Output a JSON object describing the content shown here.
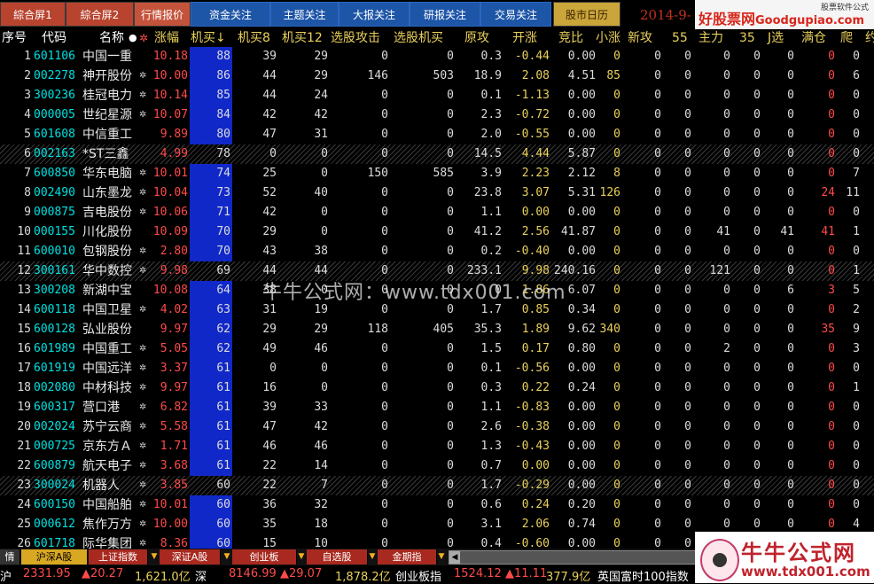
{
  "top_tabs": [
    "綜合屏1",
    "綜合屏2",
    "行情报价",
    "资金关注",
    "主题关注",
    "大报关注",
    "研报关注",
    "交易关注",
    "股市日历"
  ],
  "date_text": "2014-9-",
  "brand": {
    "main": "好股票网",
    "sub": "Goodgupiao.com",
    "corner": "股票软件公式"
  },
  "headers": [
    "序号",
    "代码",
    "名称",
    "●",
    "✲",
    "涨幅",
    "机买↓",
    "机买8",
    "机买12",
    "选股攻击",
    "选股机买",
    "原攻",
    "开涨",
    "竞比",
    "小涨",
    "新攻",
    "55",
    "主力",
    "35",
    "J选",
    "满仓",
    "爬",
    "约"
  ],
  "rows": [
    {
      "no": "1",
      "code": "601106",
      "name": "中国一重",
      "mark": "",
      "zf": "10.18",
      "jm": "88",
      "jm8": "39",
      "jm12": "29",
      "xg": "0",
      "xgj": "0",
      "yg": "0.3",
      "kz": "-0.44",
      "jb": "0.00",
      "xz": "0",
      "xg2": "0",
      "a": "0",
      "zl": "0",
      "b": "0",
      "jx": "0",
      "mc": "0",
      "p": "0",
      "hatch": false
    },
    {
      "no": "2",
      "code": "002278",
      "name": "神开股份",
      "mark": "✲",
      "zf": "10.00",
      "jm": "86",
      "jm8": "44",
      "jm12": "29",
      "xg": "146",
      "xgj": "503",
      "yg": "18.9",
      "kz": "2.08",
      "jb": "4.51",
      "xz": "85",
      "xg2": "0",
      "a": "0",
      "zl": "0",
      "b": "0",
      "jx": "0",
      "mc": "0",
      "p": "6",
      "hatch": false
    },
    {
      "no": "3",
      "code": "300236",
      "name": "桂冠电力",
      "mark": "✲",
      "zf": "10.14",
      "jm": "85",
      "jm8": "44",
      "jm12": "24",
      "xg": "0",
      "xgj": "0",
      "yg": "0.1",
      "kz": "-1.13",
      "jb": "0.00",
      "xz": "0",
      "xg2": "0",
      "a": "0",
      "zl": "0",
      "b": "0",
      "jx": "0",
      "mc": "0",
      "p": "0",
      "hatch": false
    },
    {
      "no": "4",
      "code": "000005",
      "name": "世纪星源",
      "mark": "✲",
      "zf": "10.07",
      "jm": "84",
      "jm8": "42",
      "jm12": "42",
      "xg": "0",
      "xgj": "0",
      "yg": "2.3",
      "kz": "-0.72",
      "jb": "0.00",
      "xz": "0",
      "xg2": "0",
      "a": "0",
      "zl": "0",
      "b": "0",
      "jx": "0",
      "mc": "0",
      "p": "0",
      "hatch": false
    },
    {
      "no": "5",
      "code": "601608",
      "name": "中信重工",
      "mark": "",
      "zf": "9.89",
      "jm": "80",
      "jm8": "47",
      "jm12": "31",
      "xg": "0",
      "xgj": "0",
      "yg": "2.0",
      "kz": "-0.55",
      "jb": "0.00",
      "xz": "0",
      "xg2": "0",
      "a": "0",
      "zl": "0",
      "b": "0",
      "jx": "0",
      "mc": "0",
      "p": "0",
      "hatch": false
    },
    {
      "no": "6",
      "code": "002163",
      "name": "*ST三鑫",
      "mark": "",
      "zf": "4.99",
      "jm": "78",
      "jm8": "0",
      "jm12": "0",
      "xg": "0",
      "xgj": "0",
      "yg": "14.5",
      "kz": "4.44",
      "jb": "5.87",
      "xz": "0",
      "xg2": "0",
      "a": "0",
      "zl": "0",
      "b": "0",
      "jx": "0",
      "mc": "0",
      "p": "0",
      "hatch": true
    },
    {
      "no": "7",
      "code": "600850",
      "name": "华东电脑",
      "mark": "✲",
      "zf": "10.01",
      "jm": "74",
      "jm8": "25",
      "jm12": "0",
      "xg": "150",
      "xgj": "585",
      "yg": "3.9",
      "kz": "2.23",
      "jb": "2.12",
      "xz": "8",
      "xg2": "0",
      "a": "0",
      "zl": "0",
      "b": "0",
      "jx": "0",
      "mc": "0",
      "p": "7",
      "hatch": false
    },
    {
      "no": "8",
      "code": "002490",
      "name": "山东墨龙",
      "mark": "✲",
      "zf": "10.04",
      "jm": "73",
      "jm8": "52",
      "jm12": "40",
      "xg": "0",
      "xgj": "0",
      "yg": "23.8",
      "kz": "3.07",
      "jb": "5.31",
      "xz": "126",
      "xg2": "0",
      "a": "0",
      "zl": "0",
      "b": "0",
      "jx": "0",
      "mc": "24",
      "p": "11",
      "hatch": false
    },
    {
      "no": "9",
      "code": "000875",
      "name": "吉电股份",
      "mark": "✲",
      "zf": "10.06",
      "jm": "71",
      "jm8": "42",
      "jm12": "0",
      "xg": "0",
      "xgj": "0",
      "yg": "1.1",
      "kz": "0.00",
      "jb": "0.00",
      "xz": "0",
      "xg2": "0",
      "a": "0",
      "zl": "0",
      "b": "0",
      "jx": "0",
      "mc": "0",
      "p": "0",
      "hatch": false
    },
    {
      "no": "10",
      "code": "000155",
      "name": "川化股份",
      "mark": "",
      "zf": "10.09",
      "jm": "70",
      "jm8": "29",
      "jm12": "0",
      "xg": "0",
      "xgj": "0",
      "yg": "41.2",
      "kz": "2.56",
      "jb": "41.87",
      "xz": "0",
      "xg2": "0",
      "a": "0",
      "zl": "41",
      "b": "0",
      "jx": "41",
      "mc": "41",
      "p": "1",
      "hatch": false
    },
    {
      "no": "11",
      "code": "600010",
      "name": "包钢股份",
      "mark": "✲",
      "zf": "2.80",
      "jm": "70",
      "jm8": "43",
      "jm12": "38",
      "xg": "0",
      "xgj": "0",
      "yg": "0.2",
      "kz": "-0.40",
      "jb": "0.00",
      "xz": "0",
      "xg2": "0",
      "a": "0",
      "zl": "0",
      "b": "0",
      "jx": "0",
      "mc": "0",
      "p": "0",
      "hatch": false
    },
    {
      "no": "12",
      "code": "300161",
      "name": "华中数控",
      "mark": "✲",
      "zf": "9.98",
      "jm": "69",
      "jm8": "44",
      "jm12": "44",
      "xg": "0",
      "xgj": "0",
      "yg": "233.1",
      "kz": "9.98",
      "jb": "240.16",
      "xz": "0",
      "xg2": "0",
      "a": "0",
      "zl": "121",
      "b": "0",
      "jx": "0",
      "mc": "0",
      "p": "1",
      "hatch": true
    },
    {
      "no": "13",
      "code": "300208",
      "name": "新湖中宝",
      "mark": "",
      "zf": "10.08",
      "jm": "64",
      "jm8": "38",
      "jm12": "0",
      "xg": "0",
      "xgj": "0",
      "yg": "0",
      "kz": "1.86",
      "jb": "6.07",
      "xz": "0",
      "xg2": "0",
      "a": "0",
      "zl": "0",
      "b": "0",
      "jx": "6",
      "mc": "3",
      "p": "5",
      "hatch": false
    },
    {
      "no": "14",
      "code": "600118",
      "name": "中国卫星",
      "mark": "✲",
      "zf": "4.02",
      "jm": "63",
      "jm8": "31",
      "jm12": "19",
      "xg": "0",
      "xgj": "0",
      "yg": "1.7",
      "kz": "0.85",
      "jb": "0.34",
      "xz": "0",
      "xg2": "0",
      "a": "0",
      "zl": "0",
      "b": "0",
      "jx": "0",
      "mc": "0",
      "p": "2",
      "hatch": false
    },
    {
      "no": "15",
      "code": "600128",
      "name": "弘业股份",
      "mark": "",
      "zf": "9.97",
      "jm": "62",
      "jm8": "29",
      "jm12": "29",
      "xg": "118",
      "xgj": "405",
      "yg": "35.3",
      "kz": "1.89",
      "jb": "9.62",
      "xz": "340",
      "xg2": "0",
      "a": "0",
      "zl": "0",
      "b": "0",
      "jx": "0",
      "mc": "35",
      "p": "9",
      "hatch": false
    },
    {
      "no": "16",
      "code": "601989",
      "name": "中国重工",
      "mark": "✲",
      "zf": "5.05",
      "jm": "62",
      "jm8": "49",
      "jm12": "46",
      "xg": "0",
      "xgj": "0",
      "yg": "1.5",
      "kz": "0.17",
      "jb": "0.80",
      "xz": "0",
      "xg2": "0",
      "a": "0",
      "zl": "2",
      "b": "0",
      "jx": "0",
      "mc": "0",
      "p": "3",
      "hatch": false
    },
    {
      "no": "17",
      "code": "601919",
      "name": "中国远洋",
      "mark": "✲",
      "zf": "3.37",
      "jm": "61",
      "jm8": "0",
      "jm12": "0",
      "xg": "0",
      "xgj": "0",
      "yg": "0.1",
      "kz": "-0.56",
      "jb": "0.00",
      "xz": "0",
      "xg2": "0",
      "a": "0",
      "zl": "0",
      "b": "0",
      "jx": "0",
      "mc": "0",
      "p": "0",
      "hatch": false
    },
    {
      "no": "18",
      "code": "002080",
      "name": "中材科技",
      "mark": "✲",
      "zf": "9.97",
      "jm": "61",
      "jm8": "16",
      "jm12": "0",
      "xg": "0",
      "xgj": "0",
      "yg": "0.3",
      "kz": "0.22",
      "jb": "0.24",
      "xz": "0",
      "xg2": "0",
      "a": "0",
      "zl": "0",
      "b": "0",
      "jx": "0",
      "mc": "0",
      "p": "1",
      "hatch": false
    },
    {
      "no": "19",
      "code": "600317",
      "name": "营口港",
      "mark": "✲",
      "zf": "6.82",
      "jm": "61",
      "jm8": "39",
      "jm12": "33",
      "xg": "0",
      "xgj": "0",
      "yg": "1.1",
      "kz": "-0.83",
      "jb": "0.00",
      "xz": "0",
      "xg2": "0",
      "a": "0",
      "zl": "0",
      "b": "0",
      "jx": "0",
      "mc": "0",
      "p": "0",
      "hatch": false
    },
    {
      "no": "20",
      "code": "002024",
      "name": "苏宁云商",
      "mark": "✲",
      "zf": "5.58",
      "jm": "61",
      "jm8": "47",
      "jm12": "42",
      "xg": "0",
      "xgj": "0",
      "yg": "2.6",
      "kz": "-0.38",
      "jb": "0.00",
      "xz": "0",
      "xg2": "0",
      "a": "0",
      "zl": "0",
      "b": "0",
      "jx": "0",
      "mc": "0",
      "p": "0",
      "hatch": false
    },
    {
      "no": "21",
      "code": "000725",
      "name": "京东方Ａ",
      "mark": "✲",
      "zf": "1.71",
      "jm": "61",
      "jm8": "46",
      "jm12": "46",
      "xg": "0",
      "xgj": "0",
      "yg": "1.3",
      "kz": "-0.43",
      "jb": "0.00",
      "xz": "0",
      "xg2": "0",
      "a": "0",
      "zl": "0",
      "b": "0",
      "jx": "0",
      "mc": "0",
      "p": "0",
      "hatch": false
    },
    {
      "no": "22",
      "code": "600879",
      "name": "航天电子",
      "mark": "✲",
      "zf": "3.68",
      "jm": "61",
      "jm8": "22",
      "jm12": "14",
      "xg": "0",
      "xgj": "0",
      "yg": "0.7",
      "kz": "0.00",
      "jb": "0.00",
      "xz": "0",
      "xg2": "0",
      "a": "0",
      "zl": "0",
      "b": "0",
      "jx": "0",
      "mc": "0",
      "p": "0",
      "hatch": false
    },
    {
      "no": "23",
      "code": "300024",
      "name": "机器人",
      "mark": "✲",
      "zf": "3.85",
      "jm": "60",
      "jm8": "22",
      "jm12": "7",
      "xg": "0",
      "xgj": "0",
      "yg": "1.7",
      "kz": "-0.29",
      "jb": "0.00",
      "xz": "0",
      "xg2": "0",
      "a": "0",
      "zl": "0",
      "b": "0",
      "jx": "0",
      "mc": "0",
      "p": "0",
      "hatch": true
    },
    {
      "no": "24",
      "code": "600150",
      "name": "中国船舶",
      "mark": "✲",
      "zf": "10.01",
      "jm": "60",
      "jm8": "36",
      "jm12": "32",
      "xg": "0",
      "xgj": "0",
      "yg": "0.6",
      "kz": "0.24",
      "jb": "0.20",
      "xz": "0",
      "xg2": "0",
      "a": "0",
      "zl": "0",
      "b": "0",
      "jx": "0",
      "mc": "0",
      "p": "0",
      "hatch": false
    },
    {
      "no": "25",
      "code": "000612",
      "name": "焦作万方",
      "mark": "✲",
      "zf": "10.00",
      "jm": "60",
      "jm8": "35",
      "jm12": "18",
      "xg": "0",
      "xgj": "0",
      "yg": "3.1",
      "kz": "2.06",
      "jb": "0.74",
      "xz": "0",
      "xg2": "0",
      "a": "0",
      "zl": "0",
      "b": "0",
      "jx": "0",
      "mc": "0",
      "p": "4",
      "hatch": false
    },
    {
      "no": "26",
      "code": "601718",
      "name": "际华集团",
      "mark": "✲",
      "zf": "8.36",
      "jm": "60",
      "jm8": "15",
      "jm12": "10",
      "xg": "0",
      "xgj": "0",
      "yg": "0.4",
      "kz": "-0.60",
      "jb": "0.00",
      "xz": "0",
      "xg2": "0",
      "a": "0",
      "zl": "0",
      "b": "0",
      "jx": "0",
      "mc": "0",
      "p": "0",
      "hatch": false
    }
  ],
  "watermark": "牛牛公式网：www.tdx001.com",
  "bottom_tabs": [
    "沪深A股",
    "上证指数",
    "深证A股",
    "创业板",
    "自选股",
    "金期指"
  ],
  "bottom_left": "情",
  "ticker": [
    "沪",
    "2331.95",
    "▲20.27",
    "1,621.0亿",
    "深",
    "8146.99",
    "▲29.07",
    "1,878.2亿",
    "创业板指",
    "1524.12",
    "▲11.11",
    "377.9亿",
    "英国富时100指数"
  ],
  "logo": {
    "t1": "牛牛公式网",
    "t2": "www.tdx001.com"
  },
  "colors": {
    "up": "#ff4a4a",
    "sort_column": "#1028c8",
    "header_yellow": "#e9d15b",
    "code_cyan": "#00e0e0"
  }
}
